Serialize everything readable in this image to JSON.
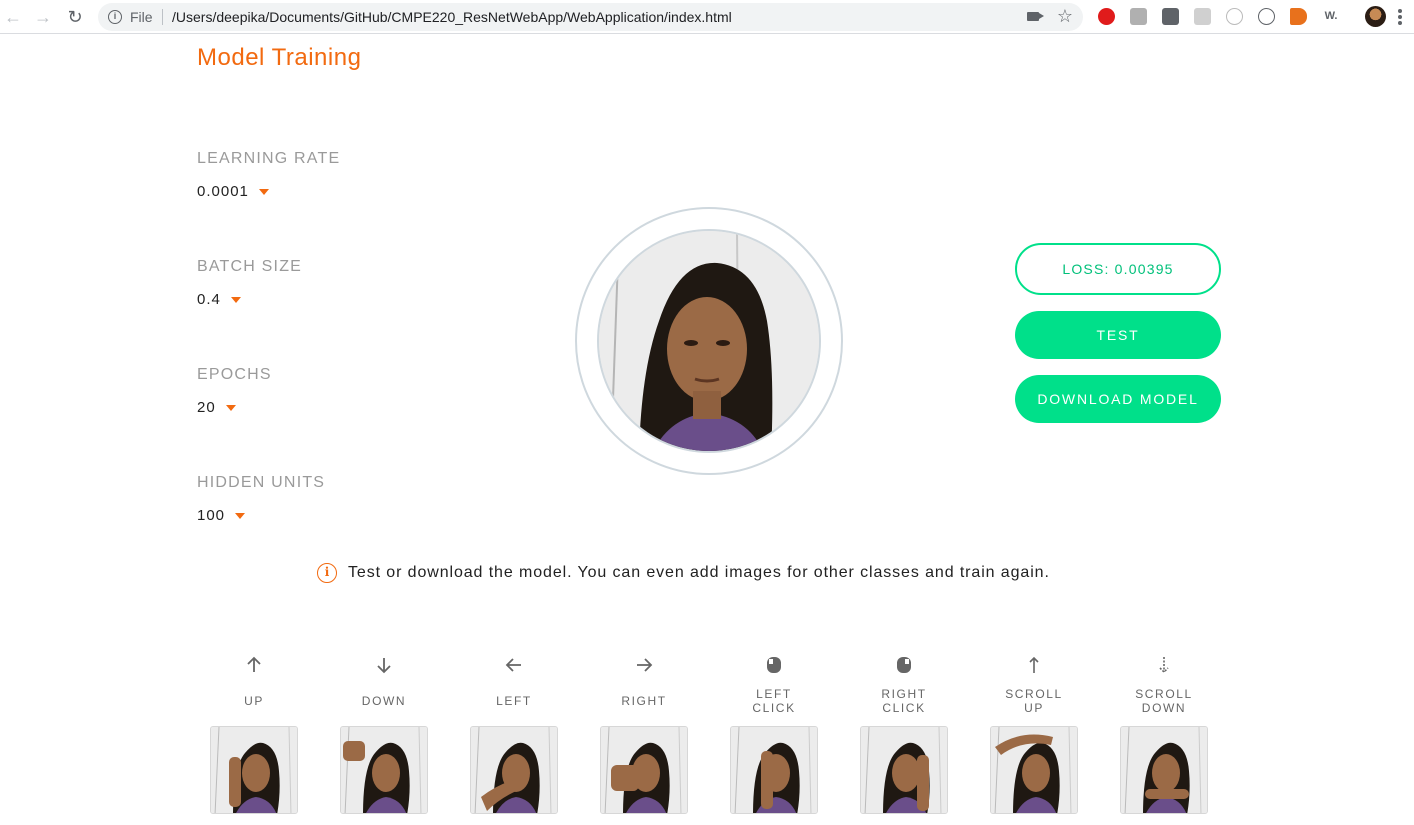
{
  "browser": {
    "scheme": "File",
    "url": "/Users/deepika/Documents/GitHub/CMPE220_ResNetWebApp/WebApplication/index.html"
  },
  "page": {
    "title": "Model Training"
  },
  "params": [
    {
      "label": "LEARNING RATE",
      "value": "0.0001"
    },
    {
      "label": "BATCH SIZE",
      "value": "0.4"
    },
    {
      "label": "EPOCHS",
      "value": "20"
    },
    {
      "label": "HIDDEN UNITS",
      "value": "100"
    }
  ],
  "actions": {
    "loss_label": "LOSS: 0.00395",
    "test_label": "TEST",
    "download_label": "DOWNLOAD MODEL"
  },
  "info": {
    "message": "Test or download the model. You can even add images for other classes and train again."
  },
  "gestures": [
    {
      "label_lines": [
        "UP"
      ],
      "icon": "arrow-up-icon"
    },
    {
      "label_lines": [
        "DOWN"
      ],
      "icon": "arrow-down-icon"
    },
    {
      "label_lines": [
        "LEFT"
      ],
      "icon": "arrow-left-icon"
    },
    {
      "label_lines": [
        "RIGHT"
      ],
      "icon": "arrow-right-icon"
    },
    {
      "label_lines": [
        "LEFT",
        "CLICK"
      ],
      "icon": "mouse-left-icon"
    },
    {
      "label_lines": [
        "RIGHT",
        "CLICK"
      ],
      "icon": "mouse-right-icon"
    },
    {
      "label_lines": [
        "SCROLL",
        "UP"
      ],
      "icon": "scroll-up-icon"
    },
    {
      "label_lines": [
        "SCROLL",
        "DOWN"
      ],
      "icon": "scroll-down-icon"
    }
  ],
  "colors": {
    "accent": "#f26a10",
    "primary": "#00e08a",
    "label_gray": "#9a9a9a"
  }
}
